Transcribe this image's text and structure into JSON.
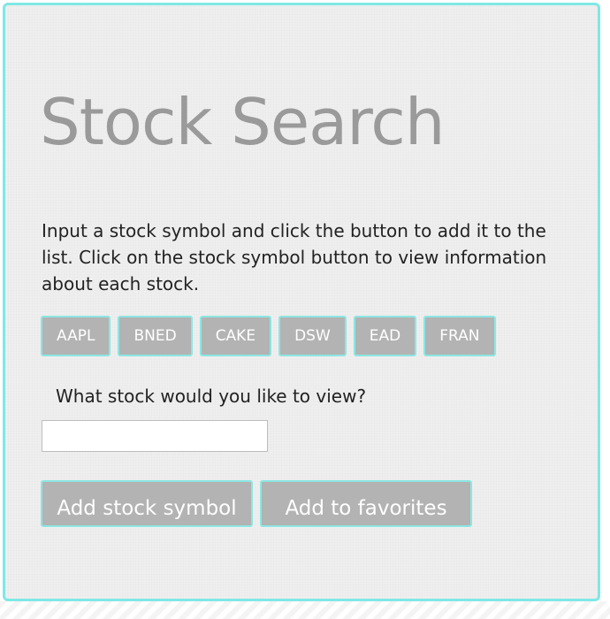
{
  "page": {
    "title": "Stock Search",
    "intro": "Input a stock symbol and click the button to add it to the list. Click on the stock symbol button to view information about each stock."
  },
  "symbols": [
    "AAPL",
    "BNED",
    "CAKE",
    "DSW",
    "EAD",
    "FRAN"
  ],
  "form": {
    "question": "What stock would you like to view?",
    "input_value": "",
    "input_placeholder": "",
    "add_label": "Add stock symbol",
    "favorites_label": "Add to favorites"
  },
  "colors": {
    "accent_border": "#7fe8e6",
    "button_bg": "#b3b3b3",
    "title_color": "#9a9a9a"
  }
}
